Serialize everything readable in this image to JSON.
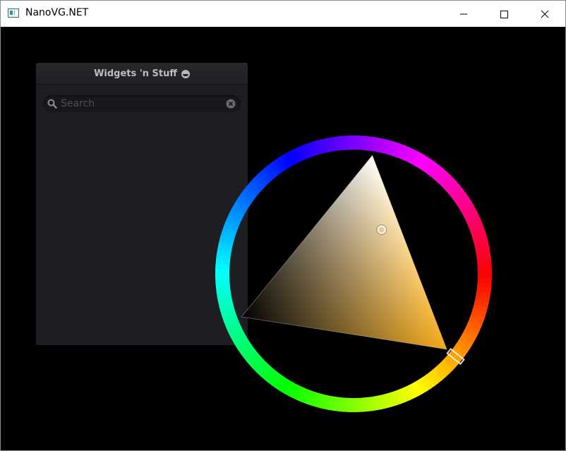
{
  "window": {
    "title": "NanoVG.NET",
    "controls": {
      "minimize_icon": "minimize-icon",
      "maximize_icon": "maximize-icon",
      "close_icon": "close-icon"
    }
  },
  "panel": {
    "title": "Widgets 'n Stuff",
    "title_icon": "smiley-icon",
    "search": {
      "value": "",
      "placeholder": "Search",
      "icon": "search-icon",
      "clear_icon": "clear-icon"
    }
  },
  "color_picker": {
    "selected_hue_deg": 39,
    "selected_color": "#f5a915"
  }
}
